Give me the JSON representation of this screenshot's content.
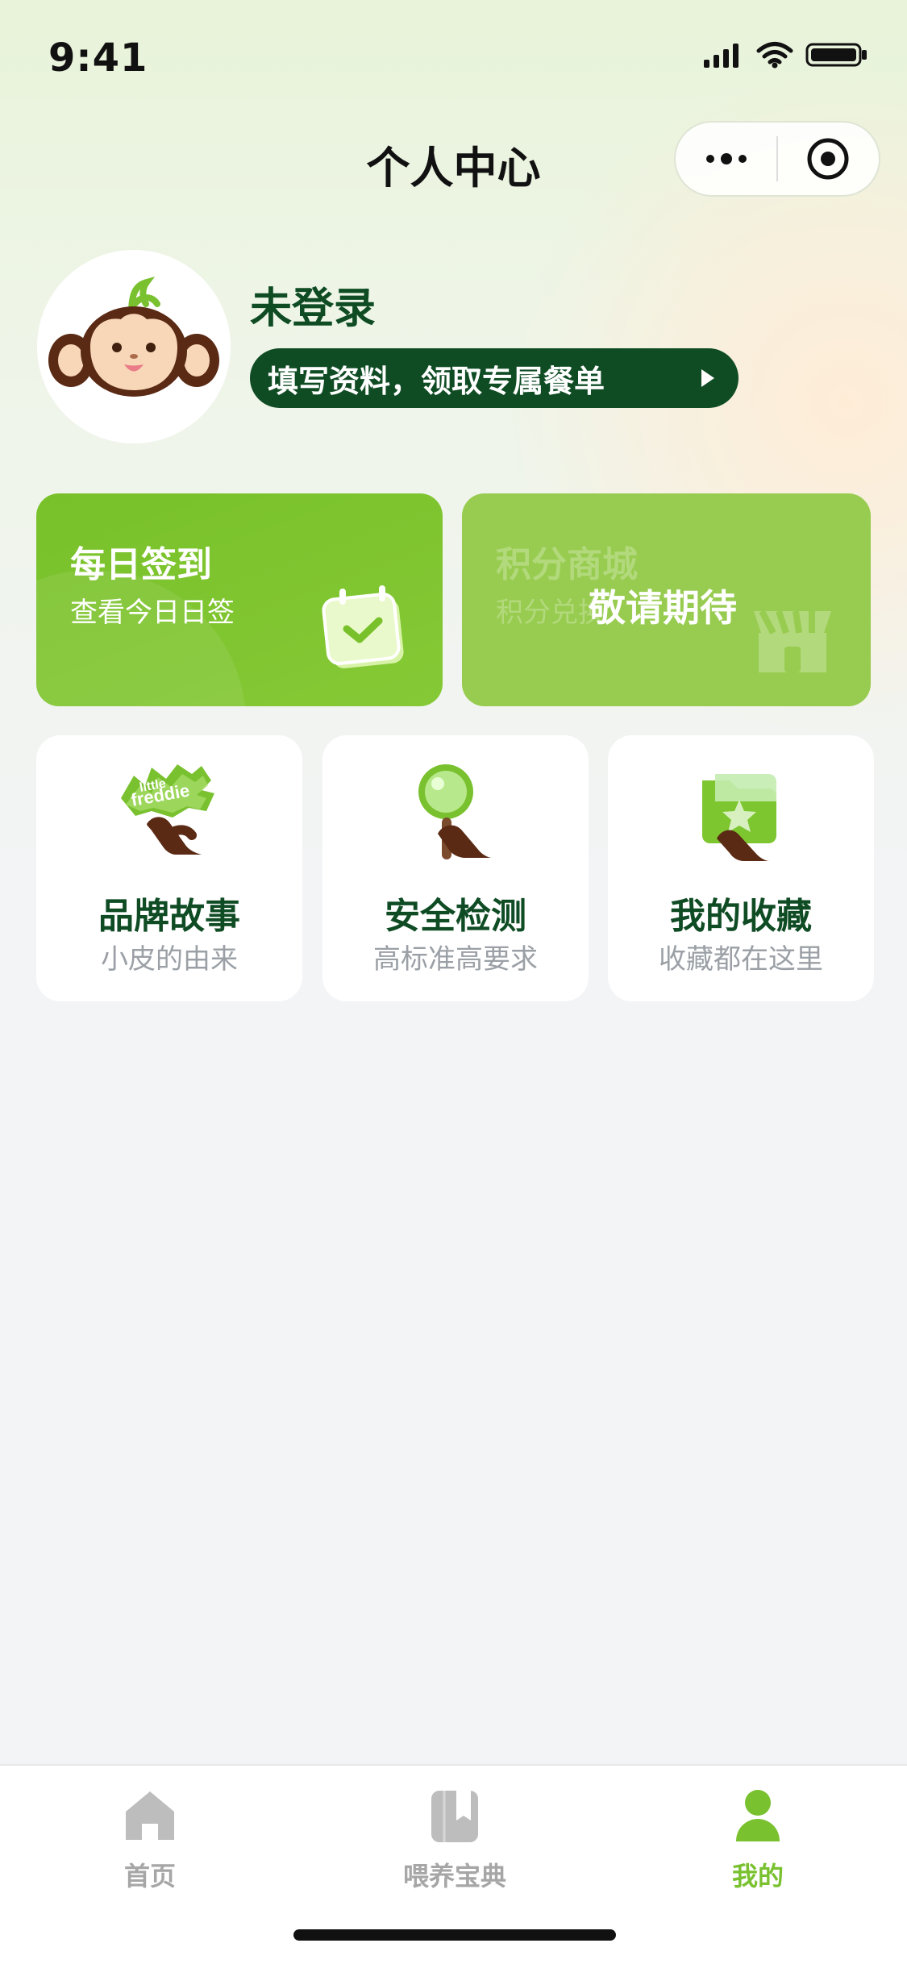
{
  "status_bar": {
    "time": "9:41"
  },
  "header": {
    "title": "个人中心"
  },
  "icons": {
    "more": "more-icon",
    "target": "target-icon",
    "calendar": "calendar-check-icon",
    "store": "store-icon",
    "home": "home-icon",
    "book": "book-icon",
    "profile": "profile-icon"
  },
  "profile": {
    "name": "未登录",
    "cta_label": "填写资料，领取专属餐单",
    "avatar_brand_text": "Little Freddie"
  },
  "feature_cards": [
    {
      "title": "每日签到",
      "subtitle": "查看今日日签"
    },
    {
      "title": "积分商城",
      "subtitle": "积分兑换",
      "overlay_text": "敬请期待"
    }
  ],
  "service_cards": [
    {
      "title": "品牌故事",
      "subtitle": "小皮的由来",
      "brand_badge_line1": "little",
      "brand_badge_line2": "freddie"
    },
    {
      "title": "安全检测",
      "subtitle": "高标准高要求"
    },
    {
      "title": "我的收藏",
      "subtitle": "收藏都在这里"
    }
  ],
  "tabbar": {
    "items": [
      {
        "label": "首页"
      },
      {
        "label": "喂养宝典"
      },
      {
        "label": "我的"
      }
    ]
  },
  "colors": {
    "brand_dark_green": "#0f4c24",
    "brand_green": "#79c12f",
    "muted_gray": "#a6a6a6"
  }
}
